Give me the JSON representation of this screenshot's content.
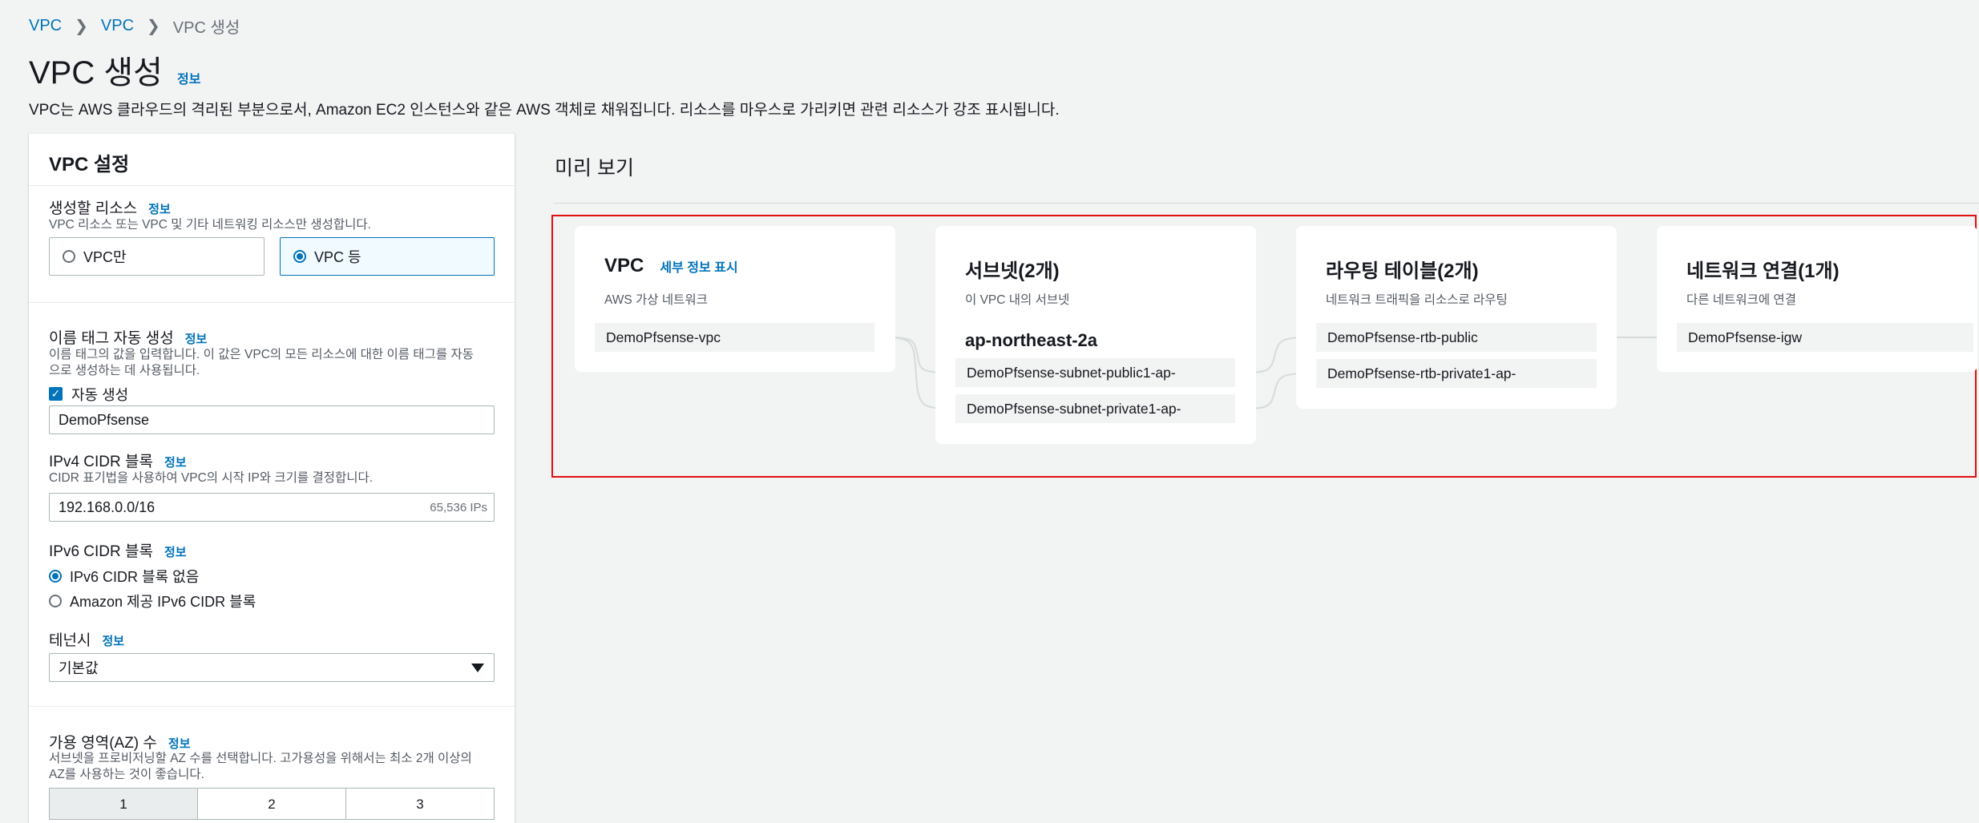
{
  "breadcrumb": [
    "VPC",
    "VPC",
    "VPC 생성"
  ],
  "page": {
    "title": "VPC 생성",
    "info_label": "정보",
    "description": "VPC는 AWS 클라우드의 격리된 부분으로서, Amazon EC2 인스턴스와 같은 AWS 객체로 채워집니다. 리소스를 마우스로 가리키면 관련 리소스가 강조 표시됩니다."
  },
  "settings": {
    "header": "VPC 설정",
    "resources": {
      "label": "생성할 리소스",
      "info": "정보",
      "desc": "VPC 리소스 또는 VPC 및 기타 네트워킹 리소스만 생성합니다.",
      "options": [
        "VPC만",
        "VPC 등"
      ],
      "selected": "VPC 등"
    },
    "name_tag": {
      "label": "이름 태그 자동 생성",
      "info": "정보",
      "desc_line1": "이름 태그의 값을 입력합니다. 이 값은 VPC의 모든 리소스에 대한 이름 태그를 자동",
      "desc_line2": "으로 생성하는 데 사용됩니다.",
      "checkbox_label": "자동 생성",
      "checked": true,
      "value": "DemoPfsense"
    },
    "ipv4": {
      "label": "IPv4 CIDR 블록",
      "info": "정보",
      "desc": "CIDR 표기법을 사용하여 VPC의 시작 IP와 크기를 결정합니다.",
      "value": "192.168.0.0/16",
      "hint": "65,536 IPs"
    },
    "ipv6": {
      "label": "IPv6 CIDR 블록",
      "info": "정보",
      "options": [
        "IPv6 CIDR 블록 없음",
        "Amazon 제공 IPv6 CIDR 블록"
      ],
      "selected": "IPv6 CIDR 블록 없음"
    },
    "tenancy": {
      "label": "테넌시",
      "info": "정보",
      "value": "기본값"
    },
    "az": {
      "label": "가용 영역(AZ) 수",
      "info": "정보",
      "desc_line1": "서브넷을 프로비저닝할 AZ 수를 선택합니다. 고가용성을 위해서는 최소 2개 이상의",
      "desc_line2": "AZ를 사용하는 것이 좋습니다.",
      "options": [
        "1",
        "2",
        "3"
      ],
      "selected": "1"
    }
  },
  "preview": {
    "title": "미리 보기",
    "vpc": {
      "title": "VPC",
      "link": "세부 정보 표시",
      "subtitle": "AWS 가상 네트워크",
      "items": [
        "DemoPfsense-vpc"
      ]
    },
    "subnets": {
      "title": "서브넷(2개)",
      "subtitle": "이 VPC 내의 서브넷",
      "az": "ap-northeast-2a",
      "items": [
        "DemoPfsense-subnet-public1-ap-",
        "DemoPfsense-subnet-private1-ap-"
      ]
    },
    "route_tables": {
      "title": "라우팅 테이블(2개)",
      "subtitle": "네트워크 트래픽을 리소스로 라우팅",
      "items": [
        "DemoPfsense-rtb-public",
        "DemoPfsense-rtb-private1-ap-"
      ]
    },
    "network": {
      "title": "네트워크 연결(1개)",
      "subtitle": "다른 네트워크에 연결",
      "items": [
        "DemoPfsense-igw"
      ]
    }
  },
  "colors": {
    "link": "#0073bb",
    "highlight_border": "#e21010",
    "background": "#f2f3f3"
  }
}
